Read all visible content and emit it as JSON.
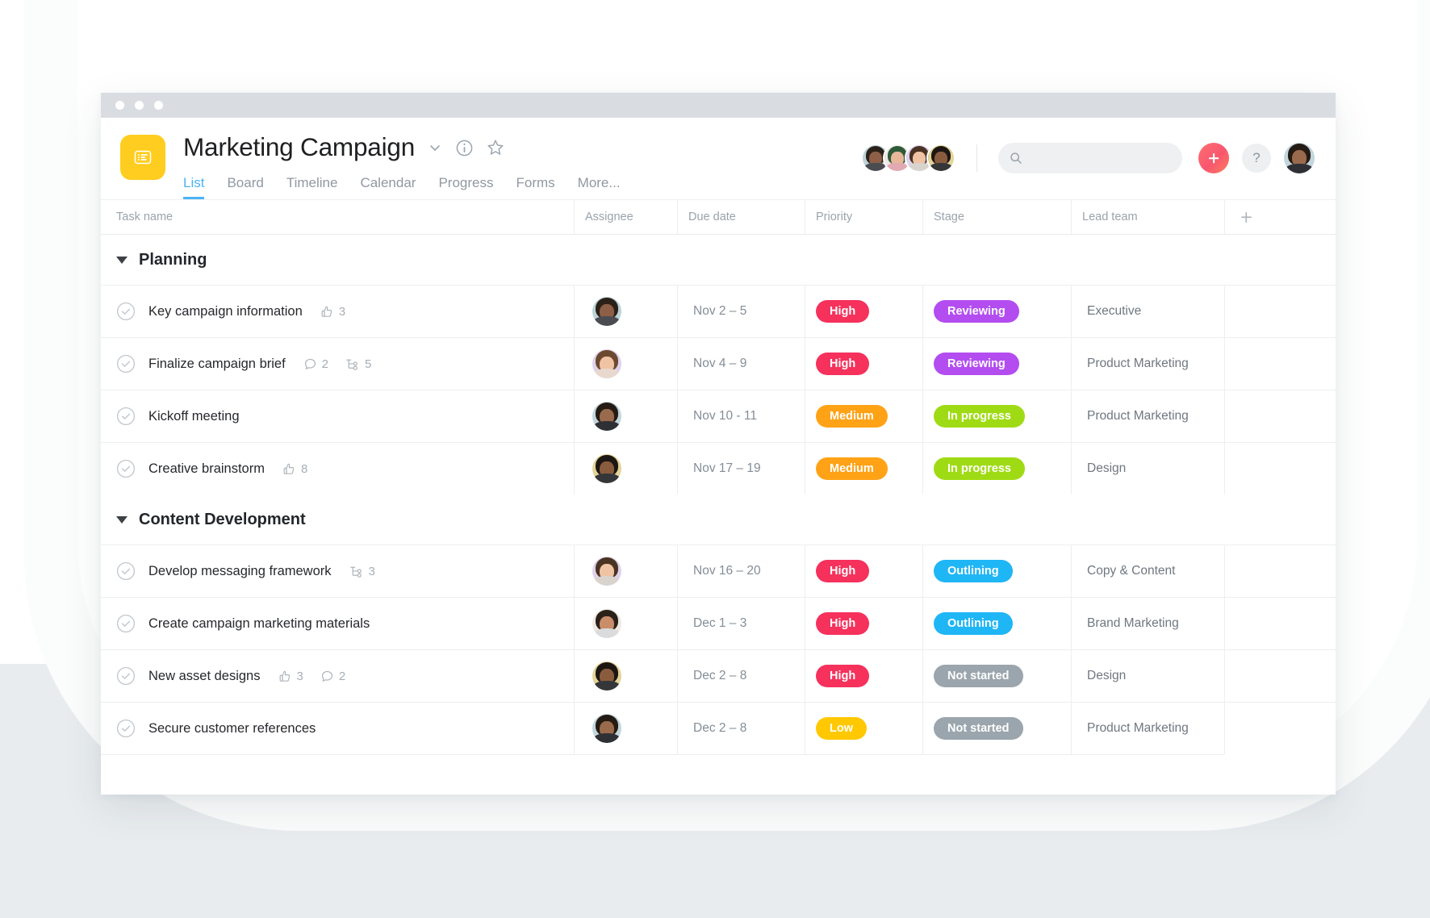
{
  "window": {
    "traffic_lights": 3
  },
  "header": {
    "project_title": "Marketing Campaign",
    "project_icon": "list-board-icon",
    "dropdown_icon": "chevron-down-icon",
    "info_icon": "info-circle-icon",
    "favorite_icon": "star-icon",
    "tabs": [
      {
        "label": "List",
        "active": true
      },
      {
        "label": "Board",
        "active": false
      },
      {
        "label": "Timeline",
        "active": false
      },
      {
        "label": "Calendar",
        "active": false
      },
      {
        "label": "Progress",
        "active": false
      },
      {
        "label": "Forms",
        "active": false
      },
      {
        "label": "More...",
        "active": false
      }
    ],
    "members": [
      {
        "name": "member-1"
      },
      {
        "name": "member-2"
      },
      {
        "name": "member-3"
      },
      {
        "name": "member-4"
      }
    ],
    "search": {
      "value": "",
      "placeholder": "",
      "icon": "search-icon"
    },
    "add_button": {
      "label": "+",
      "icon": "plus-icon",
      "color": "#f8566f"
    },
    "help_button": {
      "label": "?",
      "icon": "question-mark-icon"
    },
    "account_avatar": "current-user-avatar"
  },
  "table": {
    "columns": [
      {
        "key": "task",
        "label": "Task name"
      },
      {
        "key": "assignee",
        "label": "Assignee"
      },
      {
        "key": "due",
        "label": "Due date"
      },
      {
        "key": "priority",
        "label": "Priority"
      },
      {
        "key": "stage",
        "label": "Stage"
      },
      {
        "key": "team",
        "label": "Lead team"
      }
    ],
    "add_column_label": "+",
    "sections": [
      {
        "name": "Planning",
        "expanded": true,
        "rows": [
          {
            "task": "Key campaign information",
            "likes": "3",
            "comments": null,
            "subtasks": null,
            "due": "Nov 2 – 5",
            "priority": {
              "label": "High",
              "color": "#f5315c"
            },
            "stage": {
              "label": "Reviewing",
              "color": "#b34df0"
            },
            "team": "Executive"
          },
          {
            "task": "Finalize campaign brief",
            "likes": null,
            "comments": "2",
            "subtasks": "5",
            "due": "Nov 4 – 9",
            "priority": {
              "label": "High",
              "color": "#f5315c"
            },
            "stage": {
              "label": "Reviewing",
              "color": "#b34df0"
            },
            "team": "Product Marketing"
          },
          {
            "task": "Kickoff meeting",
            "likes": null,
            "comments": null,
            "subtasks": null,
            "due": "Nov 10 - 11",
            "priority": {
              "label": "Medium",
              "color": "#ffa216"
            },
            "stage": {
              "label": "In progress",
              "color": "#9fdb14"
            },
            "team": "Product Marketing"
          },
          {
            "task": "Creative brainstorm",
            "likes": "8",
            "comments": null,
            "subtasks": null,
            "due": "Nov 17 – 19",
            "priority": {
              "label": "Medium",
              "color": "#ffa216"
            },
            "stage": {
              "label": "In progress",
              "color": "#9fdb14"
            },
            "team": "Design"
          }
        ]
      },
      {
        "name": "Content Development",
        "expanded": true,
        "rows": [
          {
            "task": "Develop messaging framework",
            "likes": null,
            "comments": null,
            "subtasks": "3",
            "due": "Nov 16 – 20",
            "priority": {
              "label": "High",
              "color": "#f5315c"
            },
            "stage": {
              "label": "Outlining",
              "color": "#1fb6f5"
            },
            "team": "Copy & Content"
          },
          {
            "task": "Create campaign marketing materials",
            "likes": null,
            "comments": null,
            "subtasks": null,
            "due": "Dec 1 – 3",
            "priority": {
              "label": "High",
              "color": "#f5315c"
            },
            "stage": {
              "label": "Outlining",
              "color": "#1fb6f5"
            },
            "team": "Brand Marketing"
          },
          {
            "task": "New asset designs",
            "likes": "3",
            "comments": "2",
            "subtasks": null,
            "due": "Dec 2 – 8",
            "priority": {
              "label": "High",
              "color": "#f5315c"
            },
            "stage": {
              "label": "Not started",
              "color": "#9aa5ad"
            },
            "team": "Design"
          },
          {
            "task": "Secure customer references",
            "likes": null,
            "comments": null,
            "subtasks": null,
            "due": "Dec 2 – 8",
            "priority": {
              "label": "Low",
              "color": "#ffc800"
            },
            "stage": {
              "label": "Not started",
              "color": "#9aa5ad"
            },
            "team": "Product Marketing"
          }
        ]
      }
    ]
  },
  "icons": {
    "like": "thumbs-up-icon",
    "comment": "comment-bubble-icon",
    "subtask": "subtask-branch-icon",
    "check": "check-circle-icon"
  },
  "colors": {
    "accent_blue": "#4cb3f5",
    "project_icon": "#ffcd1f",
    "titlebar": "#d9dde2",
    "page_band": "#e8ecef"
  }
}
